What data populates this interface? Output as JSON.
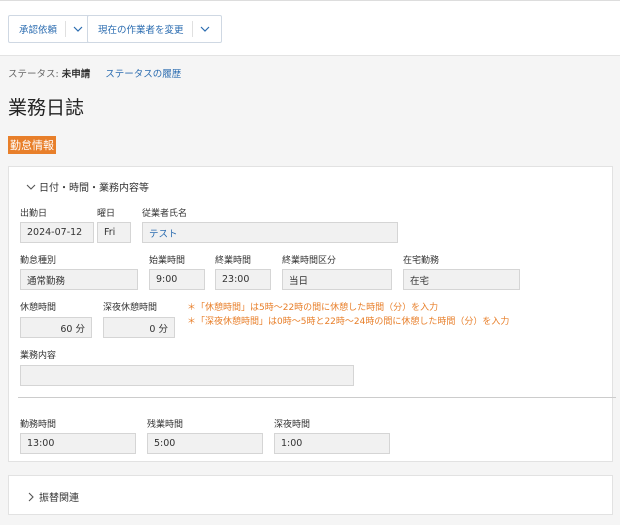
{
  "toolbar": {
    "approval_label": "承認依頼",
    "change_worker_label": "現在の作業者を変更"
  },
  "status": {
    "prefix": "ステータス:",
    "value": "未申請",
    "history_link": "ステータスの履歴"
  },
  "page_title": "業務日誌",
  "section_tag": "勤怠情報",
  "panel1": {
    "heading": "日付・時間・業務内容等",
    "fields": {
      "work_date": {
        "label": "出勤日",
        "value": "2024-07-12"
      },
      "weekday": {
        "label": "曜日",
        "value": "Fri"
      },
      "employee": {
        "label": "従業者氏名",
        "value": "テスト"
      },
      "attendance_type": {
        "label": "勤怠種別",
        "value": "通常勤務"
      },
      "start_time": {
        "label": "始業時間",
        "value": "9:00"
      },
      "end_time": {
        "label": "終業時間",
        "value": "23:00"
      },
      "end_time_category": {
        "label": "終業時間区分",
        "value": "当日"
      },
      "remote_work": {
        "label": "在宅勤務",
        "value": "在宅"
      },
      "break_time": {
        "label": "休憩時間",
        "value": "60 分"
      },
      "night_break": {
        "label": "深夜休憩時間",
        "value": "0 分"
      },
      "work_content": {
        "label": "業務内容",
        "value": ""
      },
      "work_hours": {
        "label": "勤務時間",
        "value": "13:00"
      },
      "overtime": {
        "label": "残業時間",
        "value": "5:00"
      },
      "night_hours": {
        "label": "深夜時間",
        "value": "1:00"
      }
    },
    "notes": [
      "＊「休憩時間」は5時〜22時の間に休憩した時間（分）を入力",
      "＊「深夜休憩時間」は0時〜5時と22時〜24時の間に休憩した時間（分）を入力"
    ]
  },
  "panel2": {
    "heading": "振替関連"
  }
}
